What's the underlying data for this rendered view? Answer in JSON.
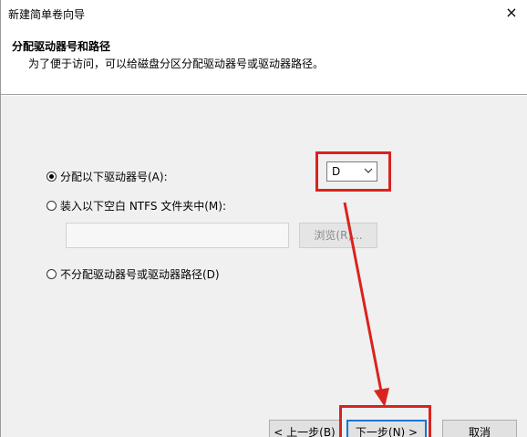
{
  "window": {
    "title": "新建简单卷向导",
    "close_glyph": "×"
  },
  "header": {
    "title": "分配驱动器号和路径",
    "description": "为了便于访问，可以给磁盘分区分配驱动器号或驱动器路径。"
  },
  "options": {
    "assign_letter_label": "分配以下驱动器号(A):",
    "mount_folder_label": "装入以下空白 NTFS 文件夹中(M):",
    "no_assign_label": "不分配驱动器号或驱动器路径(D)",
    "selected": "assign_letter"
  },
  "drive_letter": {
    "value": "D"
  },
  "folder_path": {
    "value": ""
  },
  "browse": {
    "label": "浏览(R)..."
  },
  "footer": {
    "back_label": "< 上一步(B)",
    "next_label": "下一步(N) >",
    "cancel_label": "取消"
  },
  "annotation": {
    "color": "#d9231f"
  }
}
